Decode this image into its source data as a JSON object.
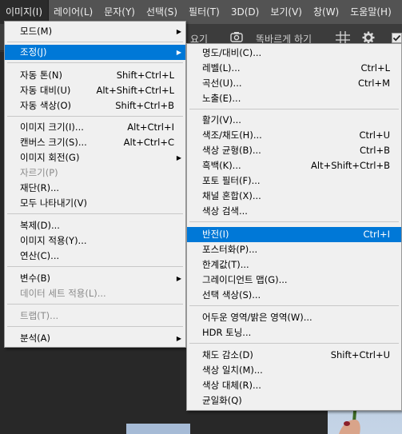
{
  "menubar": {
    "items": [
      "이미지(I)",
      "레이어(L)",
      "문자(Y)",
      "선택(S)",
      "필터(T)",
      "3D(D)",
      "보기(V)",
      "창(W)",
      "도움말(H)"
    ]
  },
  "optionsbar": {
    "partial_text": "요기",
    "straighten_label": "똑바르게 하기"
  },
  "image_menu": {
    "items": [
      {
        "label": "모드(M)",
        "shortcut": "",
        "submenu": true,
        "disabled": false
      },
      {
        "label": "조정(J)",
        "shortcut": "",
        "submenu": true,
        "disabled": false,
        "highlighted": true
      },
      {
        "label": "자동 톤(N)",
        "shortcut": "Shift+Ctrl+L"
      },
      {
        "label": "자동 대비(U)",
        "shortcut": "Alt+Shift+Ctrl+L"
      },
      {
        "label": "자동 색상(O)",
        "shortcut": "Shift+Ctrl+B"
      },
      {
        "label": "이미지 크기(I)...",
        "shortcut": "Alt+Ctrl+I"
      },
      {
        "label": "캔버스 크기(S)...",
        "shortcut": "Alt+Ctrl+C"
      },
      {
        "label": "이미지 회전(G)",
        "shortcut": "",
        "submenu": true
      },
      {
        "label": "자르기(P)",
        "shortcut": "",
        "disabled": true
      },
      {
        "label": "재단(R)...",
        "shortcut": ""
      },
      {
        "label": "모두 나타내기(V)",
        "shortcut": ""
      },
      {
        "label": "복제(D)...",
        "shortcut": ""
      },
      {
        "label": "이미지 적용(Y)...",
        "shortcut": ""
      },
      {
        "label": "연산(C)...",
        "shortcut": ""
      },
      {
        "label": "변수(B)",
        "shortcut": "",
        "submenu": true
      },
      {
        "label": "데이터 세트 적용(L)...",
        "shortcut": "",
        "disabled": true
      },
      {
        "label": "트랩(T)...",
        "shortcut": "",
        "disabled": true
      },
      {
        "label": "분석(A)",
        "shortcut": "",
        "submenu": true
      }
    ]
  },
  "adjust_menu": {
    "items": [
      {
        "label": "명도/대비(C)...",
        "shortcut": ""
      },
      {
        "label": "레벨(L)...",
        "shortcut": "Ctrl+L"
      },
      {
        "label": "곡선(U)...",
        "shortcut": "Ctrl+M"
      },
      {
        "label": "노출(E)...",
        "shortcut": ""
      },
      {
        "label": "활기(V)...",
        "shortcut": ""
      },
      {
        "label": "색조/채도(H)...",
        "shortcut": "Ctrl+U"
      },
      {
        "label": "색상 균형(B)...",
        "shortcut": "Ctrl+B"
      },
      {
        "label": "흑백(K)...",
        "shortcut": "Alt+Shift+Ctrl+B"
      },
      {
        "label": "포토 필터(F)...",
        "shortcut": ""
      },
      {
        "label": "채널 혼합(X)...",
        "shortcut": ""
      },
      {
        "label": "색상 검색...",
        "shortcut": ""
      },
      {
        "label": "반전(I)",
        "shortcut": "Ctrl+I",
        "highlighted": true
      },
      {
        "label": "포스터화(P)...",
        "shortcut": ""
      },
      {
        "label": "한계값(T)...",
        "shortcut": ""
      },
      {
        "label": "그레이디언트 맵(G)...",
        "shortcut": ""
      },
      {
        "label": "선택 색상(S)...",
        "shortcut": ""
      },
      {
        "label": "어두운 영역/밝은 영역(W)...",
        "shortcut": ""
      },
      {
        "label": "HDR 토닝...",
        "shortcut": ""
      },
      {
        "label": "채도 감소(D)",
        "shortcut": "Shift+Ctrl+U"
      },
      {
        "label": "색상 일치(M)...",
        "shortcut": ""
      },
      {
        "label": "색상 대체(R)...",
        "shortcut": ""
      },
      {
        "label": "균일화(Q)",
        "shortcut": ""
      }
    ]
  },
  "icons": {
    "submenu_arrow": "triangle-right-icon",
    "grid": "grid-icon",
    "gear": "gear-icon",
    "checkbox": "checkbox-icon"
  },
  "colors": {
    "highlight": "#0078d7",
    "menu_bg": "#f0f0f0",
    "menubar_bg": "#535353"
  }
}
